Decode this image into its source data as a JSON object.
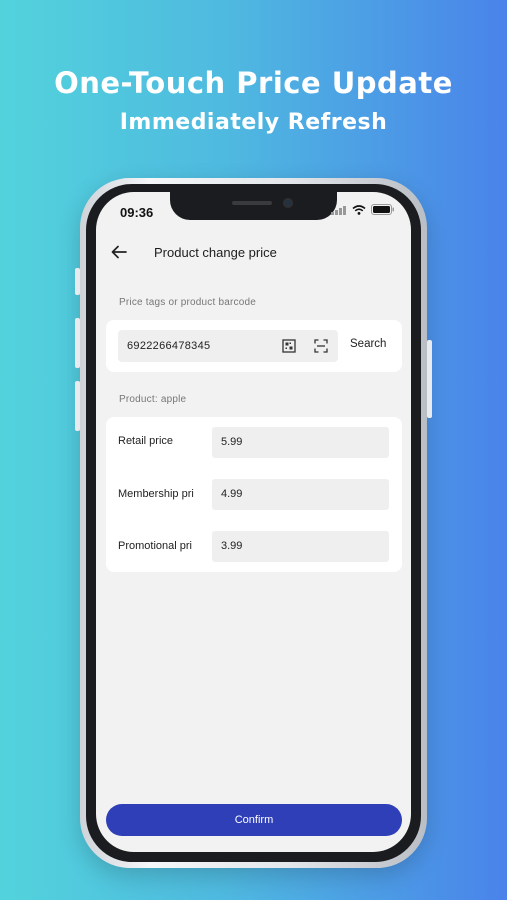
{
  "promo": {
    "headline": "One-Touch Price Update",
    "subheadline": "Immediately Refresh"
  },
  "status_bar": {
    "time": "09:36",
    "icons": [
      "signal-icon",
      "wifi-icon",
      "battery-icon"
    ]
  },
  "nav": {
    "back_icon": "back-arrow-icon",
    "title": "Product change price"
  },
  "barcode_section": {
    "label": "Price tags or product barcode",
    "value": "6922266478345",
    "icons": [
      "qr-code-icon",
      "scan-icon"
    ],
    "search_label": "Search"
  },
  "product": {
    "label": "Product: apple"
  },
  "prices": [
    {
      "label": "Retail price",
      "value": "5.99"
    },
    {
      "label": "Membership pri",
      "value": "4.99"
    },
    {
      "label": "Promotional pri",
      "value": "3.99"
    }
  ],
  "confirm_label": "Confirm",
  "colors": {
    "background_gradient_start": "#52d3dc",
    "background_gradient_end": "#4a83ea",
    "confirm_button": "#2f3fb7",
    "screen_background": "#f2f2f2"
  }
}
